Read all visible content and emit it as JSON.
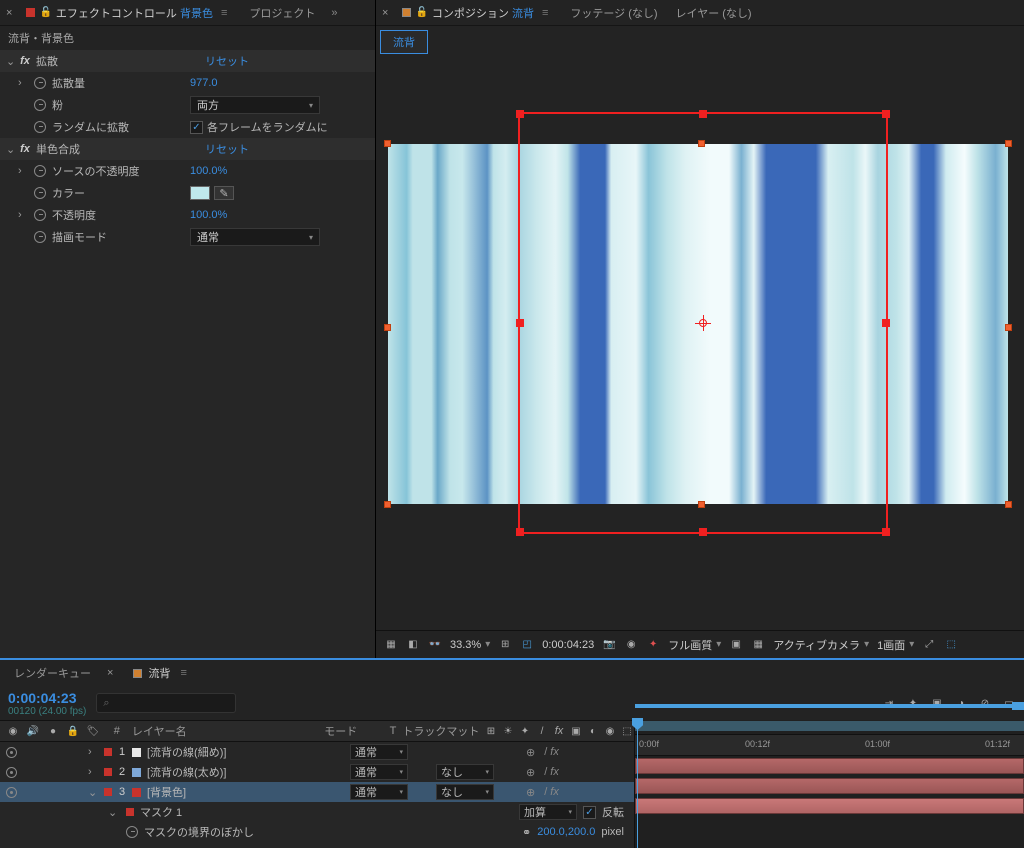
{
  "left_panel": {
    "tabs": {
      "effect_controls": "エフェクトコントロール",
      "target": "背景色",
      "project": "プロジェクト"
    },
    "crumb": "流背・背景色",
    "effects": [
      {
        "name": "拡散",
        "reset": "リセット",
        "props": [
          {
            "label": "拡散量",
            "type": "num",
            "value": "977.0",
            "twisty": true
          },
          {
            "label": "粉",
            "type": "dd",
            "value": "両方"
          },
          {
            "label": "ランダムに拡散",
            "type": "check",
            "value": "各フレームをランダムに"
          }
        ]
      },
      {
        "name": "単色合成",
        "reset": "リセット",
        "props": [
          {
            "label": "ソースの不透明度",
            "type": "pct",
            "value": "100.0",
            "twisty": true
          },
          {
            "label": "カラー",
            "type": "color",
            "color": "#bfe8ec"
          },
          {
            "label": "不透明度",
            "type": "pct",
            "value": "100.0",
            "twisty": true
          },
          {
            "label": "描画モード",
            "type": "dd",
            "value": "通常"
          }
        ]
      }
    ]
  },
  "right_panel": {
    "tabs": {
      "composition": "コンポジション",
      "comp_name": "流背",
      "footage": "フッテージ (なし)",
      "layer": "レイヤー (なし)"
    },
    "subtab": "流背"
  },
  "viewer_bar": {
    "zoom": "33.3%",
    "time": "0:00:04:23",
    "quality": "フル画質",
    "camera": "アクティブカメラ",
    "views": "1画面"
  },
  "timeline": {
    "tabs": {
      "render_queue": "レンダーキュー",
      "comp": "流背"
    },
    "timecode": "0:00:04:23",
    "frames": "00120 (24.00 fps)",
    "search_placeholder": "",
    "cols": {
      "num": "#",
      "name": "レイヤー名",
      "mode": "モード",
      "t": "T",
      "trkmat": "トラックマット"
    },
    "layers": [
      {
        "num": "1",
        "name": "[流背の線(細め)]",
        "swatch": "white",
        "mode": "通常",
        "trk": ""
      },
      {
        "num": "2",
        "name": "[流背の線(太め)]",
        "swatch": "lblue",
        "mode": "通常",
        "trk": "なし"
      },
      {
        "num": "3",
        "name": "[背景色]",
        "swatch": "red",
        "mode": "通常",
        "trk": "なし",
        "selected": true
      }
    ],
    "mask": {
      "title": "マスク 1",
      "mode": "加算",
      "invert": "反転",
      "prop_label": "マスクの境界のぼかし",
      "prop_val": "200.0,200.0",
      "unit": "pixel"
    },
    "ruler": {
      "marks": [
        "0:00f",
        "00:12f",
        "01:00f",
        "01:12f"
      ]
    }
  }
}
